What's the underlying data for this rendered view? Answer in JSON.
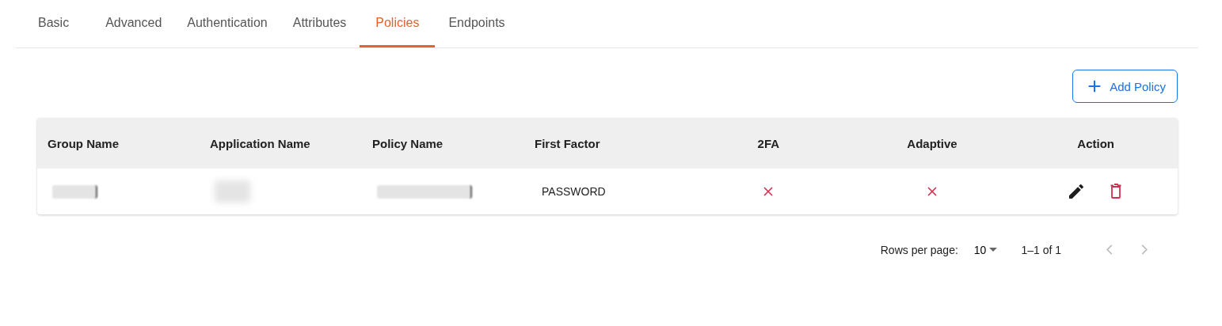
{
  "tabs": [
    {
      "label": "Basic",
      "selected": false
    },
    {
      "label": "Advanced",
      "selected": false
    },
    {
      "label": "Authentication",
      "selected": false
    },
    {
      "label": "Attributes",
      "selected": false
    },
    {
      "label": "Policies",
      "selected": true
    },
    {
      "label": "Endpoints",
      "selected": false
    }
  ],
  "add_button": {
    "label": "Add Policy"
  },
  "table": {
    "columns": [
      {
        "label": "Group Name"
      },
      {
        "label": "Application Name"
      },
      {
        "label": "Policy Name"
      },
      {
        "label": "First Factor"
      },
      {
        "label": "2FA"
      },
      {
        "label": "Adaptive"
      },
      {
        "label": "Action"
      }
    ],
    "rows": [
      {
        "group_name": {
          "redacted": true
        },
        "application_name": {
          "redacted": true
        },
        "policy_name": {
          "redacted": true
        },
        "first_factor": "PASSWORD",
        "two_fa": false,
        "adaptive": false
      }
    ]
  },
  "pagination": {
    "rows_per_page_label": "Rows per page:",
    "rows_per_page": "10",
    "range": "1–1 of 1",
    "prev_disabled": true,
    "next_disabled": true
  }
}
